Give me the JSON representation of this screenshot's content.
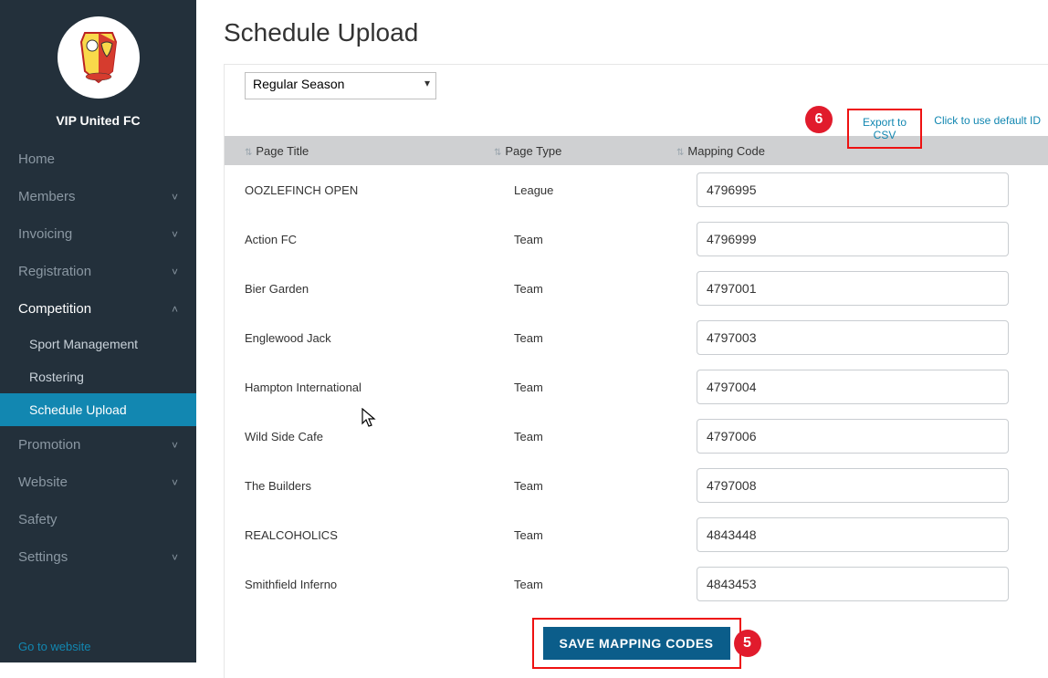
{
  "org_name": "VIP United FC",
  "sidebar": {
    "items": [
      {
        "label": "Home",
        "expandable": false
      },
      {
        "label": "Members",
        "expandable": true
      },
      {
        "label": "Invoicing",
        "expandable": true
      },
      {
        "label": "Registration",
        "expandable": true
      },
      {
        "label": "Competition",
        "expandable": true,
        "open": true,
        "subitems": [
          {
            "label": "Sport Management"
          },
          {
            "label": "Rostering"
          },
          {
            "label": "Schedule Upload",
            "active": true
          }
        ]
      },
      {
        "label": "Promotion",
        "expandable": true
      },
      {
        "label": "Website",
        "expandable": true
      },
      {
        "label": "Safety",
        "expandable": false
      },
      {
        "label": "Settings",
        "expandable": true
      }
    ],
    "footer_link": "Go to website"
  },
  "page_title": "Schedule Upload",
  "season_select": "Regular Season",
  "export_link": "Export to CSV",
  "default_id_link": "Click to use default ID",
  "annotation_6": "6",
  "annotation_5": "5",
  "table": {
    "headers": {
      "title": "Page Title",
      "type": "Page Type",
      "code": "Mapping Code"
    },
    "rows": [
      {
        "title": "OOZLEFINCH OPEN",
        "type": "League",
        "code": "4796995"
      },
      {
        "title": "Action FC",
        "type": "Team",
        "code": "4796999"
      },
      {
        "title": "Bier Garden",
        "type": "Team",
        "code": "4797001"
      },
      {
        "title": "Englewood Jack",
        "type": "Team",
        "code": "4797003"
      },
      {
        "title": "Hampton International",
        "type": "Team",
        "code": "4797004"
      },
      {
        "title": "Wild Side Cafe",
        "type": "Team",
        "code": "4797006"
      },
      {
        "title": "The Builders",
        "type": "Team",
        "code": "4797008"
      },
      {
        "title": "REALCOHOLICS",
        "type": "Team",
        "code": "4843448"
      },
      {
        "title": "Smithfield Inferno",
        "type": "Team",
        "code": "4843453"
      }
    ]
  },
  "save_button": "SAVE MAPPING CODES"
}
